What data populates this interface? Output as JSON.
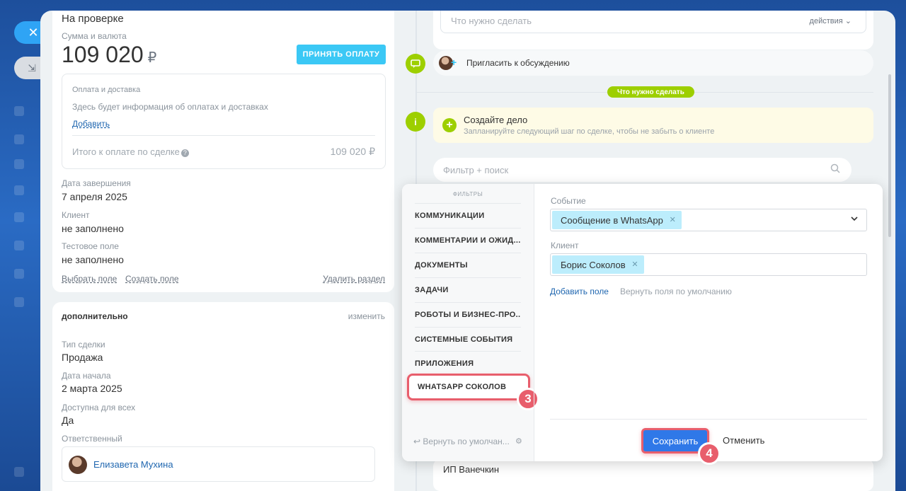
{
  "rail": {
    "close_icon": "close-icon",
    "minimize_icon": "minimize-icon"
  },
  "deal": {
    "stage": "На проверке",
    "amount_label": "Сумма и валюта",
    "amount": "109 020",
    "currency": "₽",
    "accept_payment": "ПРИНЯТЬ ОПЛАТУ",
    "payment": {
      "title": "Оплата и доставка",
      "info": "Здесь будет информация об оплатах и доставках",
      "add": "Добавить",
      "total_label": "Итого к оплате по сделке",
      "total_value": "109 020 ₽"
    },
    "fields": [
      {
        "label": "Дата завершения",
        "value": "7 апреля 2025"
      },
      {
        "label": "Клиент",
        "value": "не заполнено"
      },
      {
        "label": "Тестовое поле",
        "value": "не заполнено"
      }
    ],
    "actions": {
      "select_field": "Выбрать поле",
      "create_field": "Создать поле",
      "delete_section": "Удалить раздел"
    }
  },
  "extra": {
    "title": "дополнительно",
    "change": "изменить",
    "fields": [
      {
        "label": "Тип сделки",
        "value": "Продажа"
      },
      {
        "label": "Дата начала",
        "value": "2 марта 2025"
      },
      {
        "label": "Доступна для всех",
        "value": "Да"
      }
    ],
    "responsible_label": "Ответственный",
    "responsible_name": "Елизавета Мухина"
  },
  "timeline": {
    "todo_placeholder": "Что нужно сделать",
    "todo_actions": "действия",
    "invite": "Пригласить к обсуждению",
    "todo_badge": "Что нужно сделать",
    "create_title": "Создайте дело",
    "create_sub": "Запланируйте следующий шаг по сделке, чтобы не забыть о клиенте",
    "filter_placeholder": "Фильтр + поиск",
    "bottom_item": "ИП Ванечкин"
  },
  "filter_popup": {
    "header": "ФИЛЬТРЫ",
    "items": [
      "КОММУНИКАЦИИ",
      "КОММЕНТАРИИ И ОЖИД...",
      "ДОКУМЕНТЫ",
      "ЗАДАЧИ",
      "РОБОТЫ И БИЗНЕС-ПРО...",
      "СИСТЕМНЫЕ СОБЫТИЯ",
      "ПРИЛОЖЕНИЯ",
      "WHATSAPP СОКОЛОВ"
    ],
    "active_step": "3",
    "reset_default": "Вернуть по умолчан...",
    "event_label": "Событие",
    "event_value": "Сообщение в WhatsApp",
    "client_label": "Клиент",
    "client_value": "Борис Соколов",
    "add_field": "Добавить поле",
    "reset_fields": "Вернуть поля по умолчанию",
    "save": "Сохранить",
    "save_step": "4",
    "cancel": "Отменить"
  },
  "colors": {
    "accent": "#2f78e8",
    "highlight": "#e85e6c",
    "green": "#9dcf00",
    "chip": "#bcedfc"
  }
}
